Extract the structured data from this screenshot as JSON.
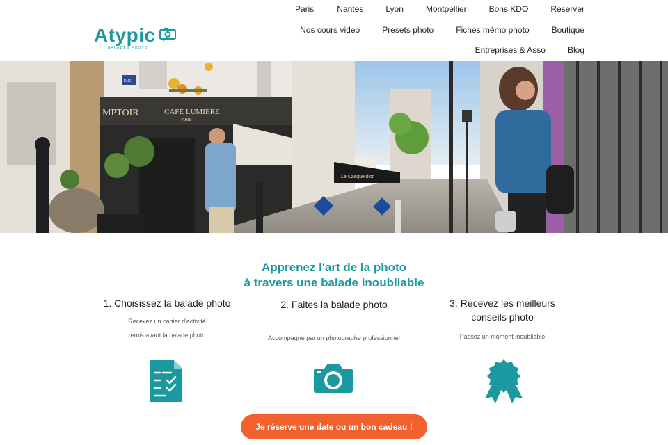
{
  "brand": {
    "name": "Atypic",
    "tagline": "BALADES PHOTO",
    "color": "#1a9aa0"
  },
  "nav": {
    "row1": [
      "Paris",
      "Nantes",
      "Lyon",
      "Montpellier",
      "Bons KDO",
      "Réserver"
    ],
    "row2": [
      "Nos cours video",
      "Presets photo",
      "Fiches mémo photo",
      "Boutique"
    ],
    "row3": [
      "Entreprises & Asso",
      "Blog"
    ]
  },
  "hero": {
    "sign_comptoir": "MPTOIR",
    "sign_cafe": "CAFÉ LUMIÈRE",
    "sign_paris": "PARIS",
    "sign_street": "RUE",
    "sign_casque": "Le Casque d'or"
  },
  "headline": {
    "line1": "Apprenez l'art de la photo",
    "line2": "à travers une balade inoubliable"
  },
  "steps": [
    {
      "title": "1. Choisissez la balade photo",
      "desc_line1": "Recevez un cahier d'activité",
      "desc_line2": "remis avant la balade photo",
      "icon": "checklist-icon"
    },
    {
      "title": "2. Faites la balade photo",
      "desc_line1": "Accompagné par un photographe professionnel",
      "icon": "camera-icon"
    },
    {
      "title_line1": "3. Recevez les meilleurs",
      "title_line2": "conseils photo",
      "desc_line1": "Passez un moment inoubliable",
      "icon": "award-ribbon-icon"
    }
  ],
  "cta": {
    "label": "Je réserve une date ou un bon cadeau !",
    "color": "#f0612d"
  }
}
